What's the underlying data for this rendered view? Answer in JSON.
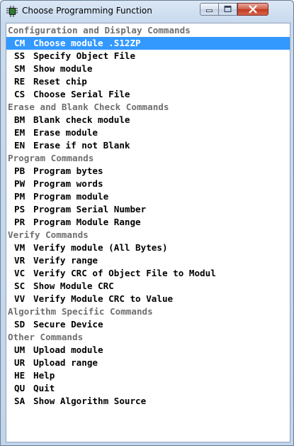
{
  "window": {
    "title": "Choose Programming Function"
  },
  "sections": [
    {
      "header": "Configuration and Display Commands",
      "items": [
        {
          "code": "CM",
          "label": "Choose module .S12ZP",
          "selected": true
        },
        {
          "code": "SS",
          "label": "Specify Object File"
        },
        {
          "code": "SM",
          "label": "Show module"
        },
        {
          "code": "RE",
          "label": "Reset chip"
        },
        {
          "code": "CS",
          "label": "Choose Serial File"
        }
      ]
    },
    {
      "header": "Erase and Blank Check Commands",
      "items": [
        {
          "code": "BM",
          "label": "Blank check module"
        },
        {
          "code": "EM",
          "label": "Erase module"
        },
        {
          "code": "EN",
          "label": "Erase if not Blank"
        }
      ]
    },
    {
      "header": "Program Commands",
      "items": [
        {
          "code": "PB",
          "label": "Program bytes"
        },
        {
          "code": "PW",
          "label": "Program words"
        },
        {
          "code": "PM",
          "label": "Program module"
        },
        {
          "code": "PS",
          "label": "Program Serial Number"
        },
        {
          "code": "PR",
          "label": "Program Module Range"
        }
      ]
    },
    {
      "header": "Verify Commands",
      "items": [
        {
          "code": "VM",
          "label": "Verify module (All Bytes)"
        },
        {
          "code": "VR",
          "label": "Verify range"
        },
        {
          "code": "VC",
          "label": "Verify CRC of Object File to Modul"
        },
        {
          "code": "SC",
          "label": "Show Module CRC"
        },
        {
          "code": "VV",
          "label": "Verify Module CRC to Value"
        }
      ]
    },
    {
      "header": "Algorithm Specific Commands",
      "items": [
        {
          "code": "SD",
          "label": "Secure Device"
        }
      ]
    },
    {
      "header": "Other Commands",
      "items": [
        {
          "code": "UM",
          "label": "Upload module"
        },
        {
          "code": "UR",
          "label": "Upload range"
        },
        {
          "code": "HE",
          "label": "Help"
        },
        {
          "code": "QU",
          "label": "Quit"
        },
        {
          "code": "SA",
          "label": "Show Algorithm Source"
        }
      ]
    }
  ]
}
